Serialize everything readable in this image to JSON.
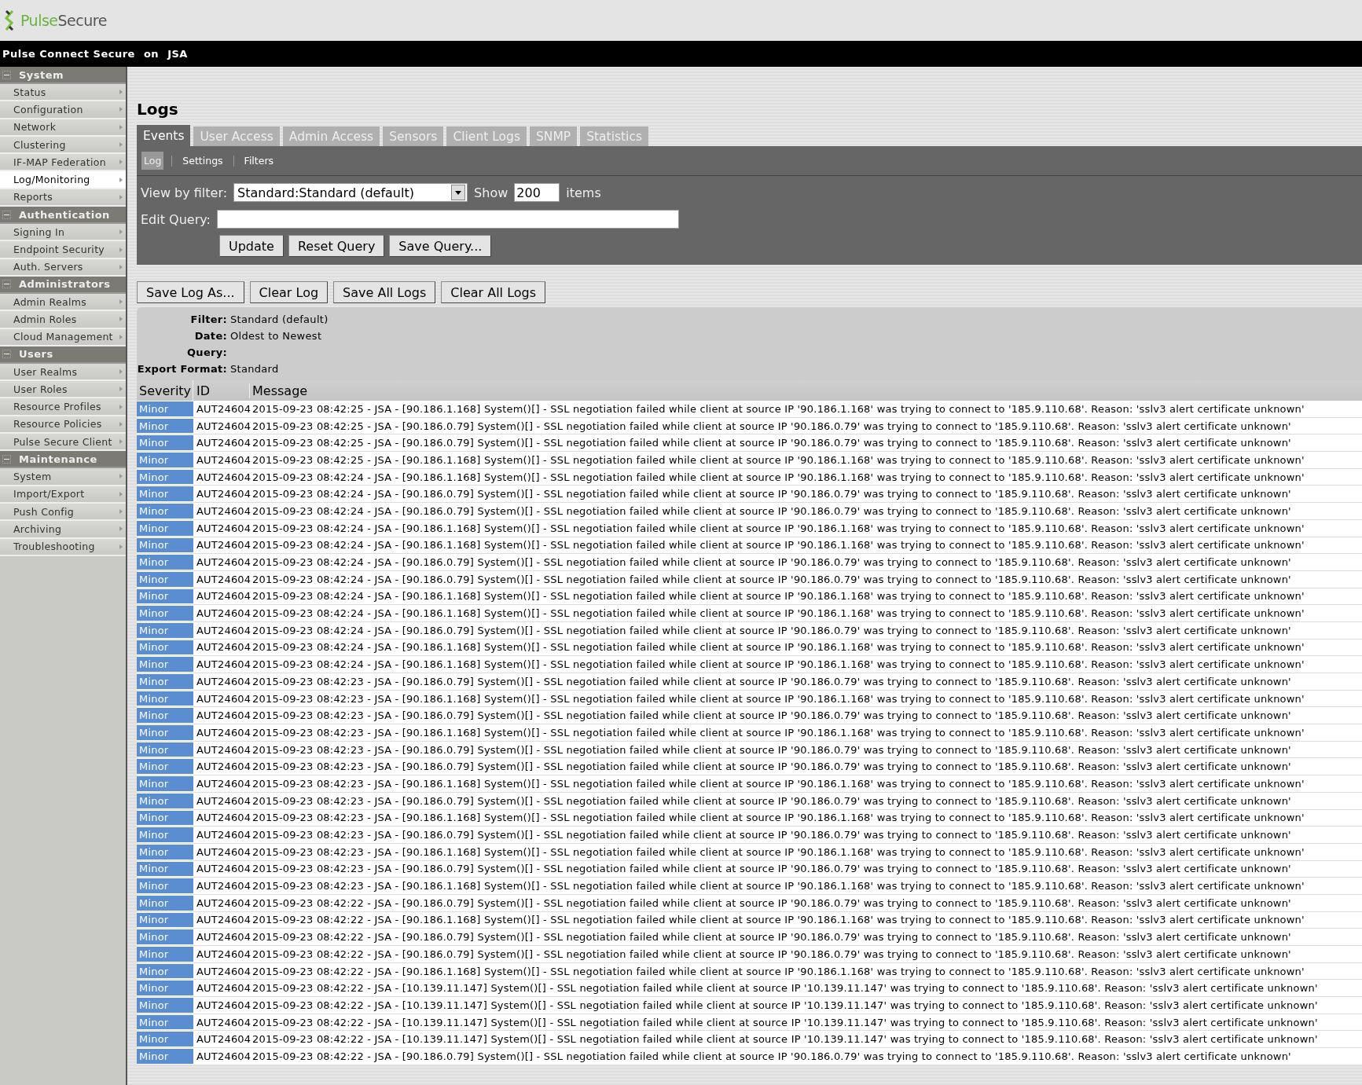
{
  "brand": {
    "name_part1": "Pulse",
    "name_part2": "Secure"
  },
  "topbar": {
    "product": "Pulse Connect Secure",
    "on": "on",
    "host": "JSA"
  },
  "sidebar": [
    {
      "title": "System",
      "expanded": true,
      "items": [
        {
          "label": "Status",
          "selected": false
        },
        {
          "label": "Configuration",
          "selected": false
        },
        {
          "label": "Network",
          "selected": false
        },
        {
          "label": "Clustering",
          "selected": false
        },
        {
          "label": "IF-MAP Federation",
          "selected": false
        },
        {
          "label": "Log/Monitoring",
          "selected": true
        },
        {
          "label": "Reports",
          "selected": false
        }
      ]
    },
    {
      "title": "Authentication",
      "expanded": true,
      "items": [
        {
          "label": "Signing In",
          "selected": false
        },
        {
          "label": "Endpoint Security",
          "selected": false
        },
        {
          "label": "Auth. Servers",
          "selected": false
        }
      ]
    },
    {
      "title": "Administrators",
      "expanded": true,
      "items": [
        {
          "label": "Admin Realms",
          "selected": false
        },
        {
          "label": "Admin Roles",
          "selected": false
        },
        {
          "label": "Cloud Management",
          "selected": false
        }
      ]
    },
    {
      "title": "Users",
      "expanded": true,
      "items": [
        {
          "label": "User Realms",
          "selected": false
        },
        {
          "label": "User Roles",
          "selected": false
        },
        {
          "label": "Resource Profiles",
          "selected": false
        },
        {
          "label": "Resource Policies",
          "selected": false
        },
        {
          "label": "Pulse Secure Client",
          "selected": false
        }
      ]
    },
    {
      "title": "Maintenance",
      "expanded": true,
      "items": [
        {
          "label": "System",
          "selected": false
        },
        {
          "label": "Import/Export",
          "selected": false
        },
        {
          "label": "Push Config",
          "selected": false
        },
        {
          "label": "Archiving",
          "selected": false
        },
        {
          "label": "Troubleshooting",
          "selected": false
        }
      ]
    }
  ],
  "page_title": "Logs",
  "tabs": [
    {
      "label": "Events",
      "selected": true
    },
    {
      "label": "User Access",
      "selected": false
    },
    {
      "label": "Admin Access",
      "selected": false
    },
    {
      "label": "Sensors",
      "selected": false
    },
    {
      "label": "Client Logs",
      "selected": false
    },
    {
      "label": "SNMP",
      "selected": false
    },
    {
      "label": "Statistics",
      "selected": false
    }
  ],
  "subtabs": [
    {
      "label": "Log",
      "selected": true
    },
    {
      "label": "Settings",
      "selected": false
    },
    {
      "label": "Filters",
      "selected": false
    }
  ],
  "query_form": {
    "filter_label": "View by filter:",
    "filter_value": "Standard:Standard (default)",
    "show_label": "Show",
    "show_value": "200",
    "items_label": "items",
    "query_label": "Edit Query:",
    "buttons": [
      "Update",
      "Reset Query",
      "Save Query..."
    ]
  },
  "log_buttons": [
    "Save Log As...",
    "Clear Log",
    "Save All Logs",
    "Clear All Logs"
  ],
  "summary": [
    {
      "label": "Filter:",
      "value": "Standard (default)"
    },
    {
      "label": "Date:",
      "value": "Oldest to Newest"
    },
    {
      "label": "Query:"
    },
    {
      "label": "Export Format:",
      "value": "Standard"
    }
  ],
  "table": {
    "columns": [
      "Severity",
      "ID",
      "Message"
    ],
    "rows": [
      {
        "severity": "Minor",
        "id": "AUT24604",
        "message": "2015-09-23 08:42:25 - JSA - [90.186.1.168] System()[] - SSL negotiation failed while client at source IP '90.186.1.168' was trying to connect to '185.9.110.68'. Reason: 'sslv3 alert certificate unknown'"
      },
      {
        "severity": "Minor",
        "id": "AUT24604",
        "message": "2015-09-23 08:42:25 - JSA - [90.186.0.79] System()[] - SSL negotiation failed while client at source IP '90.186.0.79' was trying to connect to '185.9.110.68'. Reason: 'sslv3 alert certificate unknown'"
      },
      {
        "severity": "Minor",
        "id": "AUT24604",
        "message": "2015-09-23 08:42:25 - JSA - [90.186.0.79] System()[] - SSL negotiation failed while client at source IP '90.186.0.79' was trying to connect to '185.9.110.68'. Reason: 'sslv3 alert certificate unknown'"
      },
      {
        "severity": "Minor",
        "id": "AUT24604",
        "message": "2015-09-23 08:42:25 - JSA - [90.186.1.168] System()[] - SSL negotiation failed while client at source IP '90.186.1.168' was trying to connect to '185.9.110.68'. Reason: 'sslv3 alert certificate unknown'"
      },
      {
        "severity": "Minor",
        "id": "AUT24604",
        "message": "2015-09-23 08:42:24 - JSA - [90.186.1.168] System()[] - SSL negotiation failed while client at source IP '90.186.1.168' was trying to connect to '185.9.110.68'. Reason: 'sslv3 alert certificate unknown'"
      },
      {
        "severity": "Minor",
        "id": "AUT24604",
        "message": "2015-09-23 08:42:24 - JSA - [90.186.0.79] System()[] - SSL negotiation failed while client at source IP '90.186.0.79' was trying to connect to '185.9.110.68'. Reason: 'sslv3 alert certificate unknown'"
      },
      {
        "severity": "Minor",
        "id": "AUT24604",
        "message": "2015-09-23 08:42:24 - JSA - [90.186.0.79] System()[] - SSL negotiation failed while client at source IP '90.186.0.79' was trying to connect to '185.9.110.68'. Reason: 'sslv3 alert certificate unknown'"
      },
      {
        "severity": "Minor",
        "id": "AUT24604",
        "message": "2015-09-23 08:42:24 - JSA - [90.186.1.168] System()[] - SSL negotiation failed while client at source IP '90.186.1.168' was trying to connect to '185.9.110.68'. Reason: 'sslv3 alert certificate unknown'"
      },
      {
        "severity": "Minor",
        "id": "AUT24604",
        "message": "2015-09-23 08:42:24 - JSA - [90.186.1.168] System()[] - SSL negotiation failed while client at source IP '90.186.1.168' was trying to connect to '185.9.110.68'. Reason: 'sslv3 alert certificate unknown'"
      },
      {
        "severity": "Minor",
        "id": "AUT24604",
        "message": "2015-09-23 08:42:24 - JSA - [90.186.0.79] System()[] - SSL negotiation failed while client at source IP '90.186.0.79' was trying to connect to '185.9.110.68'. Reason: 'sslv3 alert certificate unknown'"
      },
      {
        "severity": "Minor",
        "id": "AUT24604",
        "message": "2015-09-23 08:42:24 - JSA - [90.186.0.79] System()[] - SSL negotiation failed while client at source IP '90.186.0.79' was trying to connect to '185.9.110.68'. Reason: 'sslv3 alert certificate unknown'"
      },
      {
        "severity": "Minor",
        "id": "AUT24604",
        "message": "2015-09-23 08:42:24 - JSA - [90.186.1.168] System()[] - SSL negotiation failed while client at source IP '90.186.1.168' was trying to connect to '185.9.110.68'. Reason: 'sslv3 alert certificate unknown'"
      },
      {
        "severity": "Minor",
        "id": "AUT24604",
        "message": "2015-09-23 08:42:24 - JSA - [90.186.1.168] System()[] - SSL negotiation failed while client at source IP '90.186.1.168' was trying to connect to '185.9.110.68'. Reason: 'sslv3 alert certificate unknown'"
      },
      {
        "severity": "Minor",
        "id": "AUT24604",
        "message": "2015-09-23 08:42:24 - JSA - [90.186.0.79] System()[] - SSL negotiation failed while client at source IP '90.186.0.79' was trying to connect to '185.9.110.68'. Reason: 'sslv3 alert certificate unknown'"
      },
      {
        "severity": "Minor",
        "id": "AUT24604",
        "message": "2015-09-23 08:42:24 - JSA - [90.186.1.168] System()[] - SSL negotiation failed while client at source IP '90.186.1.168' was trying to connect to '185.9.110.68'. Reason: 'sslv3 alert certificate unknown'"
      },
      {
        "severity": "Minor",
        "id": "AUT24604",
        "message": "2015-09-23 08:42:24 - JSA - [90.186.1.168] System()[] - SSL negotiation failed while client at source IP '90.186.1.168' was trying to connect to '185.9.110.68'. Reason: 'sslv3 alert certificate unknown'"
      },
      {
        "severity": "Minor",
        "id": "AUT24604",
        "message": "2015-09-23 08:42:23 - JSA - [90.186.0.79] System()[] - SSL negotiation failed while client at source IP '90.186.0.79' was trying to connect to '185.9.110.68'. Reason: 'sslv3 alert certificate unknown'"
      },
      {
        "severity": "Minor",
        "id": "AUT24604",
        "message": "2015-09-23 08:42:23 - JSA - [90.186.1.168] System()[] - SSL negotiation failed while client at source IP '90.186.1.168' was trying to connect to '185.9.110.68'. Reason: 'sslv3 alert certificate unknown'"
      },
      {
        "severity": "Minor",
        "id": "AUT24604",
        "message": "2015-09-23 08:42:23 - JSA - [90.186.0.79] System()[] - SSL negotiation failed while client at source IP '90.186.0.79' was trying to connect to '185.9.110.68'. Reason: 'sslv3 alert certificate unknown'"
      },
      {
        "severity": "Minor",
        "id": "AUT24604",
        "message": "2015-09-23 08:42:23 - JSA - [90.186.1.168] System()[] - SSL negotiation failed while client at source IP '90.186.1.168' was trying to connect to '185.9.110.68'. Reason: 'sslv3 alert certificate unknown'"
      },
      {
        "severity": "Minor",
        "id": "AUT24604",
        "message": "2015-09-23 08:42:23 - JSA - [90.186.0.79] System()[] - SSL negotiation failed while client at source IP '90.186.0.79' was trying to connect to '185.9.110.68'. Reason: 'sslv3 alert certificate unknown'"
      },
      {
        "severity": "Minor",
        "id": "AUT24604",
        "message": "2015-09-23 08:42:23 - JSA - [90.186.0.79] System()[] - SSL negotiation failed while client at source IP '90.186.0.79' was trying to connect to '185.9.110.68'. Reason: 'sslv3 alert certificate unknown'"
      },
      {
        "severity": "Minor",
        "id": "AUT24604",
        "message": "2015-09-23 08:42:23 - JSA - [90.186.1.168] System()[] - SSL negotiation failed while client at source IP '90.186.1.168' was trying to connect to '185.9.110.68'. Reason: 'sslv3 alert certificate unknown'"
      },
      {
        "severity": "Minor",
        "id": "AUT24604",
        "message": "2015-09-23 08:42:23 - JSA - [90.186.0.79] System()[] - SSL negotiation failed while client at source IP '90.186.0.79' was trying to connect to '185.9.110.68'. Reason: 'sslv3 alert certificate unknown'"
      },
      {
        "severity": "Minor",
        "id": "AUT24604",
        "message": "2015-09-23 08:42:23 - JSA - [90.186.1.168] System()[] - SSL negotiation failed while client at source IP '90.186.1.168' was trying to connect to '185.9.110.68'. Reason: 'sslv3 alert certificate unknown'"
      },
      {
        "severity": "Minor",
        "id": "AUT24604",
        "message": "2015-09-23 08:42:23 - JSA - [90.186.0.79] System()[] - SSL negotiation failed while client at source IP '90.186.0.79' was trying to connect to '185.9.110.68'. Reason: 'sslv3 alert certificate unknown'"
      },
      {
        "severity": "Minor",
        "id": "AUT24604",
        "message": "2015-09-23 08:42:23 - JSA - [90.186.1.168] System()[] - SSL negotiation failed while client at source IP '90.186.1.168' was trying to connect to '185.9.110.68'. Reason: 'sslv3 alert certificate unknown'"
      },
      {
        "severity": "Minor",
        "id": "AUT24604",
        "message": "2015-09-23 08:42:23 - JSA - [90.186.0.79] System()[] - SSL negotiation failed while client at source IP '90.186.0.79' was trying to connect to '185.9.110.68'. Reason: 'sslv3 alert certificate unknown'"
      },
      {
        "severity": "Minor",
        "id": "AUT24604",
        "message": "2015-09-23 08:42:23 - JSA - [90.186.1.168] System()[] - SSL negotiation failed while client at source IP '90.186.1.168' was trying to connect to '185.9.110.68'. Reason: 'sslv3 alert certificate unknown'"
      },
      {
        "severity": "Minor",
        "id": "AUT24604",
        "message": "2015-09-23 08:42:22 - JSA - [90.186.0.79] System()[] - SSL negotiation failed while client at source IP '90.186.0.79' was trying to connect to '185.9.110.68'. Reason: 'sslv3 alert certificate unknown'"
      },
      {
        "severity": "Minor",
        "id": "AUT24604",
        "message": "2015-09-23 08:42:22 - JSA - [90.186.1.168] System()[] - SSL negotiation failed while client at source IP '90.186.1.168' was trying to connect to '185.9.110.68'. Reason: 'sslv3 alert certificate unknown'"
      },
      {
        "severity": "Minor",
        "id": "AUT24604",
        "message": "2015-09-23 08:42:22 - JSA - [90.186.0.79] System()[] - SSL negotiation failed while client at source IP '90.186.0.79' was trying to connect to '185.9.110.68'. Reason: 'sslv3 alert certificate unknown'"
      },
      {
        "severity": "Minor",
        "id": "AUT24604",
        "message": "2015-09-23 08:42:22 - JSA - [90.186.0.79] System()[] - SSL negotiation failed while client at source IP '90.186.0.79' was trying to connect to '185.9.110.68'. Reason: 'sslv3 alert certificate unknown'"
      },
      {
        "severity": "Minor",
        "id": "AUT24604",
        "message": "2015-09-23 08:42:22 - JSA - [90.186.1.168] System()[] - SSL negotiation failed while client at source IP '90.186.1.168' was trying to connect to '185.9.110.68'. Reason: 'sslv3 alert certificate unknown'"
      },
      {
        "severity": "Minor",
        "id": "AUT24604",
        "message": "2015-09-23 08:42:22 - JSA - [10.139.11.147] System()[] - SSL negotiation failed while client at source IP '10.139.11.147' was trying to connect to '185.9.110.68'. Reason: 'sslv3 alert certificate unknown'"
      },
      {
        "severity": "Minor",
        "id": "AUT24604",
        "message": "2015-09-23 08:42:22 - JSA - [10.139.11.147] System()[] - SSL negotiation failed while client at source IP '10.139.11.147' was trying to connect to '185.9.110.68'. Reason: 'sslv3 alert certificate unknown'"
      },
      {
        "severity": "Minor",
        "id": "AUT24604",
        "message": "2015-09-23 08:42:22 - JSA - [10.139.11.147] System()[] - SSL negotiation failed while client at source IP '10.139.11.147' was trying to connect to '185.9.110.68'. Reason: 'sslv3 alert certificate unknown'"
      },
      {
        "severity": "Minor",
        "id": "AUT24604",
        "message": "2015-09-23 08:42:22 - JSA - [10.139.11.147] System()[] - SSL negotiation failed while client at source IP '10.139.11.147' was trying to connect to '185.9.110.68'. Reason: 'sslv3 alert certificate unknown'"
      },
      {
        "severity": "Minor",
        "id": "AUT24604",
        "message": "2015-09-23 08:42:22 - JSA - [90.186.0.79] System()[] - SSL negotiation failed while client at source IP '90.186.0.79' was trying to connect to '185.9.110.68'. Reason: 'sslv3 alert certificate unknown'"
      }
    ]
  }
}
